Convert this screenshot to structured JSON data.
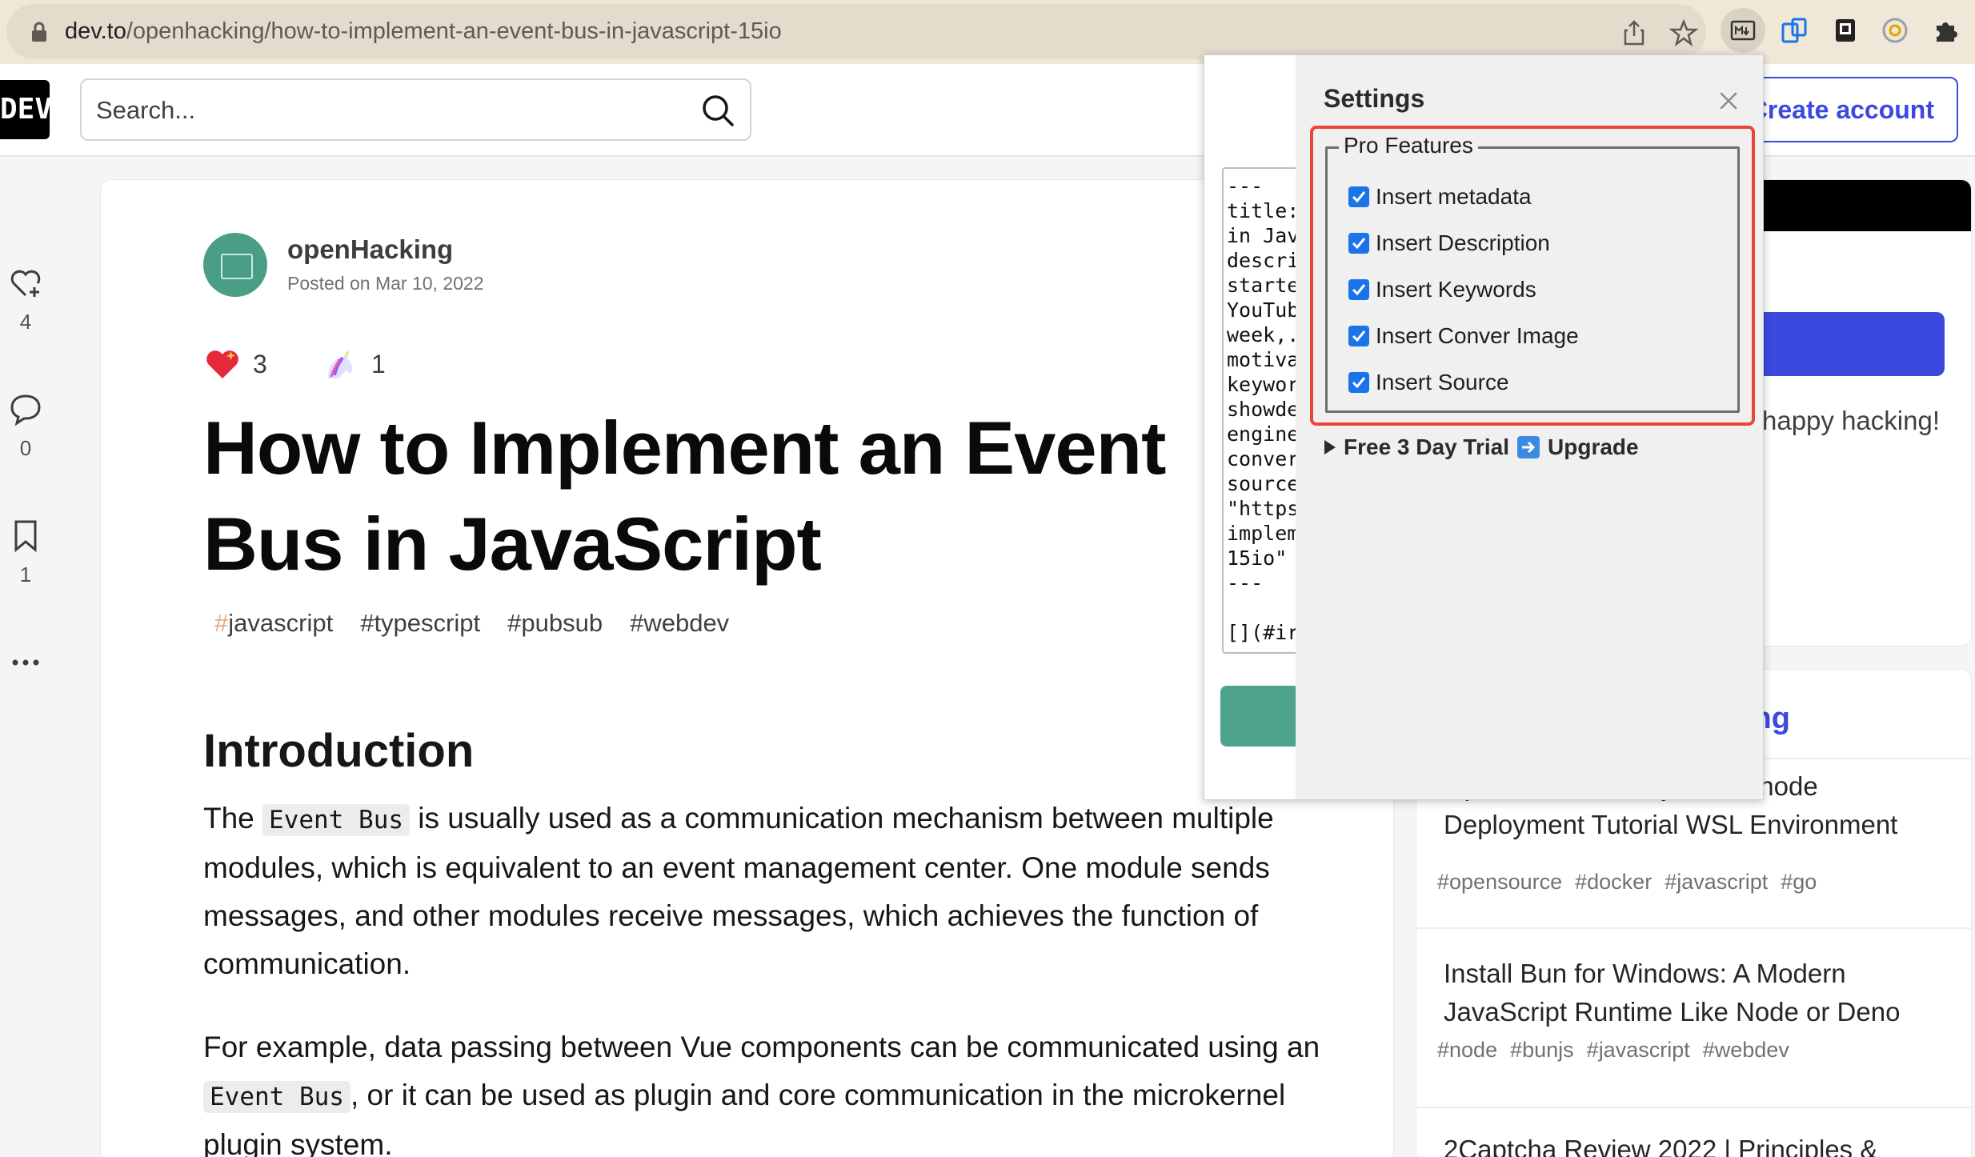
{
  "browser": {
    "url_domain": "dev.to",
    "url_path": "/openhacking/how-to-implement-an-event-bus-in-javascript-15io"
  },
  "header": {
    "logo": "DEV",
    "search_placeholder": "Search...",
    "create_account": "Create account"
  },
  "left_rail": {
    "likes": "4",
    "comments": "0",
    "bookmarks": "1"
  },
  "article": {
    "author": "openHacking",
    "posted": "Posted on Mar 10, 2022",
    "reactions": [
      {
        "icon": "heart-reaction-icon",
        "count": "3"
      },
      {
        "icon": "unicorn-reaction-icon",
        "count": "1"
      }
    ],
    "title": "How to Implement an Event Bus in JavaScript",
    "tags": [
      "javascript",
      "typescript",
      "pubsub",
      "webdev"
    ],
    "heading": "Introduction",
    "p1_before": "The ",
    "p1_code": "Event Bus",
    "p1_after": " is usually used as a communication mechanism between multiple modules, which is equivalent to an event management center. One module sends messages, and other modules receive messages, which achieves the function of communication.",
    "p2_before": "For example, data passing between Vue components can be communicated using an ",
    "p2_code": "Event Bus",
    "p2_after": ", or it can be used as plugin and core communication in the microkernel plugin system."
  },
  "sidebar": {
    "happy_text": "happy hacking!",
    "section_heading": "ing",
    "items": [
      {
        "title": "Open Source IM System Tinode Deployment Tutorial WSL Environment",
        "tags": [
          "#opensource",
          "#docker",
          "#javascript",
          "#go"
        ]
      },
      {
        "title": "Install Bun for Windows: A Modern JavaScript Runtime Like Node or Deno",
        "tags": [
          "#node",
          "#bunjs",
          "#javascript",
          "#webdev"
        ]
      },
      {
        "title": "2Captcha Review 2022 | Principles &",
        "tags": []
      }
    ]
  },
  "popup": {
    "markdown_preview": "---\ntitle:\nin Jav\ndescri\nstarte\nYouTub\nweek,.\nmotiva\nkeywor\nshowde\nengine\nconver\nsource\n\"https\nimplem\n15io\"\n---\n\n[](#ir",
    "settings_title": "Settings",
    "fieldset_legend": "Pro Features",
    "options": [
      {
        "label": "Insert metadata",
        "checked": true
      },
      {
        "label": "Insert Description",
        "checked": true
      },
      {
        "label": "Insert Keywords",
        "checked": true
      },
      {
        "label": "Insert Conver Image",
        "checked": true
      },
      {
        "label": "Insert Source",
        "checked": true
      }
    ],
    "trial_text": "Free 3 Day Trial",
    "upgrade_text": "Upgrade"
  },
  "colors": {
    "accent": "#3b49df",
    "highlight_border": "#e8463a",
    "checkbox": "#1a73e8",
    "popup_button": "#4ea38d"
  }
}
